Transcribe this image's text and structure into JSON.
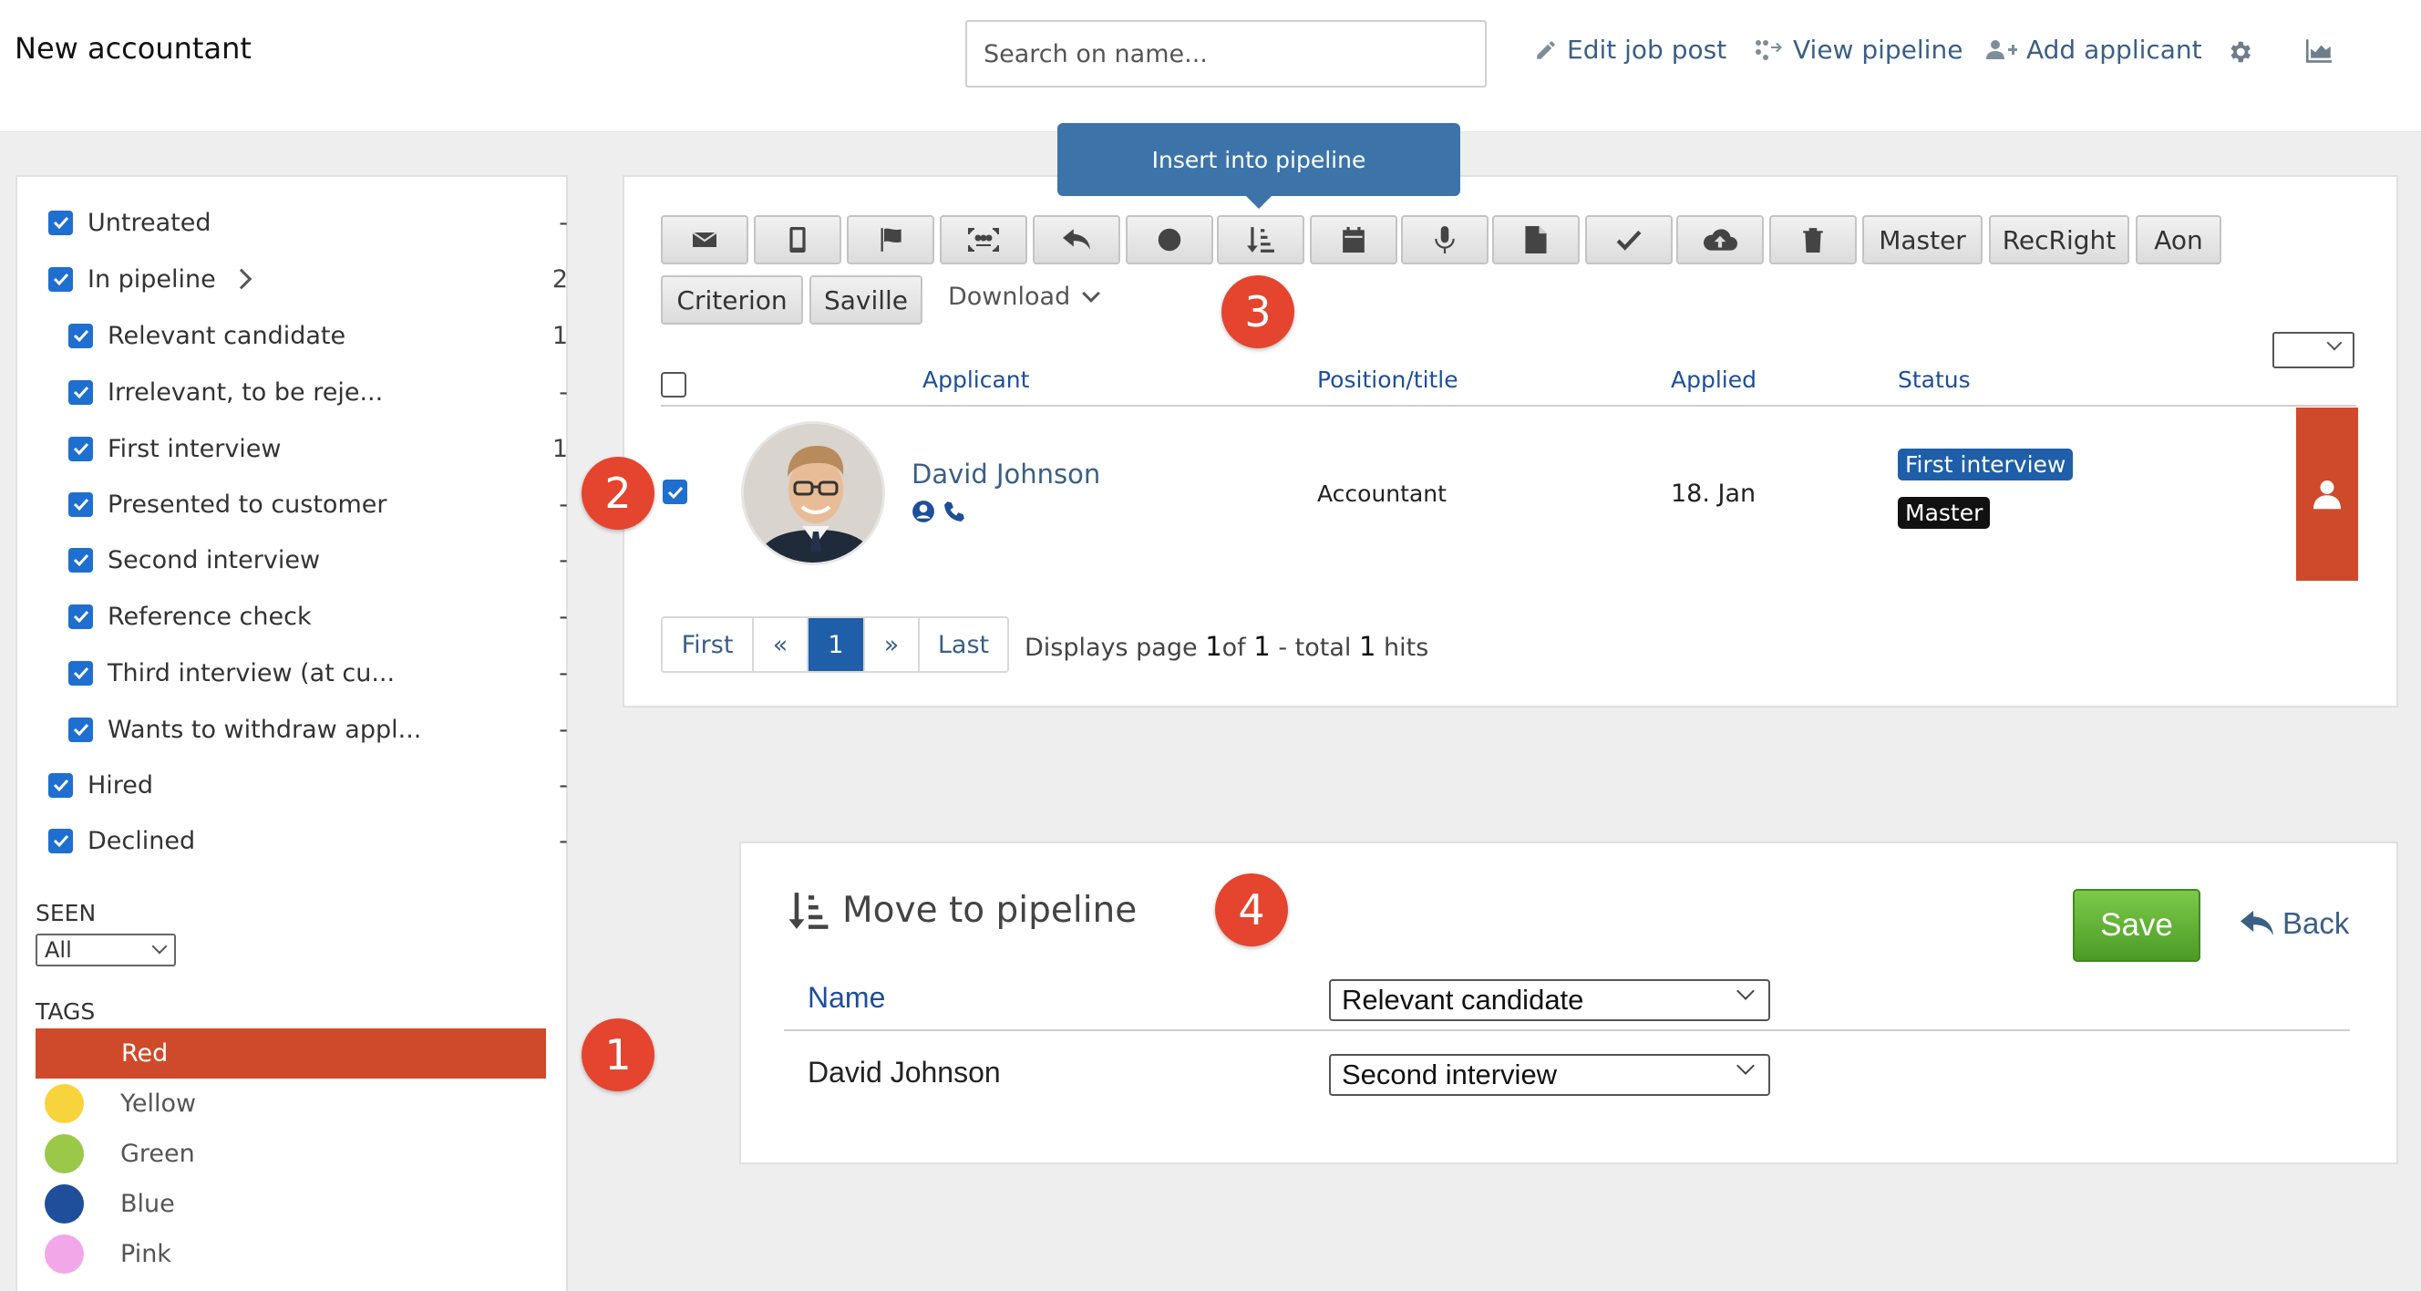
{
  "header": {
    "job_title": "New accountant",
    "search_placeholder": "Search on name...",
    "links": {
      "edit_job_post": "Edit job post",
      "view_pipeline": "View pipeline",
      "add_applicant": "Add applicant"
    }
  },
  "sidebar": {
    "filters": [
      {
        "label": "Untreated",
        "count": "-"
      },
      {
        "label": "In pipeline",
        "count": "2"
      },
      {
        "label": "Relevant candidate",
        "count": "1"
      },
      {
        "label": "Irrelevant, to be reje...",
        "count": "-"
      },
      {
        "label": "First interview",
        "count": "1"
      },
      {
        "label": "Presented to customer",
        "count": "-"
      },
      {
        "label": "Second interview",
        "count": "-"
      },
      {
        "label": "Reference check",
        "count": "-"
      },
      {
        "label": "Third interview (at cu...",
        "count": "-"
      },
      {
        "label": "Wants to withdraw appl...",
        "count": "-"
      },
      {
        "label": "Hired",
        "count": "-"
      },
      {
        "label": "Declined",
        "count": "-"
      }
    ],
    "seen_label": "SEEN",
    "seen_value": "All",
    "tags_label": "TAGS",
    "tags": [
      {
        "label": "Red",
        "color": "#cf4a2a"
      },
      {
        "label": "Yellow",
        "color": "#f8d43c"
      },
      {
        "label": "Green",
        "color": "#9cc84a"
      },
      {
        "label": "Blue",
        "color": "#1f4e9a"
      },
      {
        "label": "Pink",
        "color": "#f2a7e8"
      }
    ]
  },
  "annotations": [
    "1",
    "2",
    "3",
    "4"
  ],
  "toolbar": {
    "tooltip": "Insert into pipeline",
    "icon_buttons": [
      "mail-icon",
      "mobile-icon",
      "flag-icon",
      "scan-face-icon",
      "reply-icon",
      "block-icon",
      "sort-insert-icon",
      "calendar-icon",
      "microphone-icon",
      "document-icon",
      "check-icon",
      "cloud-upload-icon",
      "trash-icon"
    ],
    "text_buttons": [
      "Master",
      "RecRight",
      "Aon",
      "Criterion",
      "Saville"
    ],
    "download_label": "Download"
  },
  "table": {
    "columns": [
      "Applicant",
      "Position/title",
      "Applied",
      "Status"
    ],
    "rows": [
      {
        "name": "David Johnson",
        "position": "Accountant",
        "applied": "18. Jan",
        "status": "First interview",
        "tag": "Master"
      }
    ]
  },
  "pagination": {
    "first": "First",
    "prev": "«",
    "current": "1",
    "next": "»",
    "last": "Last",
    "info_prefix": "Displays page",
    "page": "1",
    "info_of": "of",
    "total_pages": "1",
    "info_total": "- total",
    "hits": "1",
    "info_hits": "hits"
  },
  "move_panel": {
    "title": "Move to pipeline",
    "save_label": "Save",
    "back_label": "Back",
    "name_header": "Name",
    "header_select": "Relevant candidate",
    "applicant_name": "David Johnson",
    "applicant_select": "Second interview"
  },
  "colors": {
    "accent_blue": "#1f5ea8",
    "link_blue": "#3b5f85",
    "tag_red": "#cf4a2a",
    "save_green": "#5aab2e",
    "badge_red": "#e5442f"
  }
}
